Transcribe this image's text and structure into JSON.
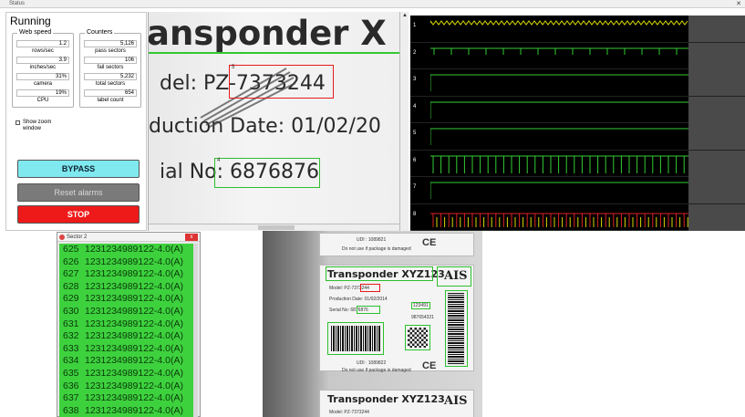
{
  "window": {
    "title": "Status"
  },
  "control_panel": {
    "status": "Running",
    "web_speed_group": {
      "title": "Web speed",
      "stats": [
        {
          "value": "1.2",
          "label": "rows/sec"
        },
        {
          "value": "3.9",
          "label": "inches/sec"
        },
        {
          "value": "31%",
          "label": "camera"
        },
        {
          "value": "19%",
          "label": "CPU"
        }
      ]
    },
    "counters_group": {
      "title": "Counters",
      "stats": [
        {
          "value": "5,126",
          "label": "pass sectors"
        },
        {
          "value": "106",
          "label": "fail sectors"
        },
        {
          "value": "5,232",
          "label": "total sectors"
        },
        {
          "value": "654",
          "label": "label count"
        }
      ]
    },
    "zoom_checkbox": {
      "label": "Show zoom window",
      "checked": true
    },
    "buttons": {
      "bypass": "BYPASS",
      "reset": "Reset alarms",
      "stop": "STOP"
    }
  },
  "label_image": {
    "title_text": "ansponder X",
    "model_text": "del: PZ-7373244",
    "date_text": "duction Date:  01/02/20",
    "serial_text": "ial No: 6876876",
    "roi_numbers": [
      "5",
      "4"
    ]
  },
  "signal_panel": {
    "channels": [
      {
        "num": "1",
        "color": "#d8d800",
        "pattern": "dense"
      },
      {
        "num": "2",
        "color": "#33cc33",
        "pattern": "sparse"
      },
      {
        "num": "3",
        "color": "#33cc33",
        "pattern": "flat"
      },
      {
        "num": "4",
        "color": "#33cc33",
        "pattern": "flat"
      },
      {
        "num": "5",
        "color": "#33cc33",
        "pattern": "flat"
      },
      {
        "num": "6",
        "color": "#33cc33",
        "pattern": "tall"
      },
      {
        "num": "7",
        "color": "#33cc33",
        "pattern": "flat"
      },
      {
        "num": "8",
        "color": "#dd2222",
        "pattern": "mixed"
      }
    ]
  },
  "sector_window": {
    "title": "Sector 2",
    "close": "x",
    "rows": [
      {
        "idx": "625",
        "code": "1231234989122-4.0(A)"
      },
      {
        "idx": "626",
        "code": "1231234989122-4.0(A)"
      },
      {
        "idx": "627",
        "code": "1231234989122-4.0(A)"
      },
      {
        "idx": "628",
        "code": "1231234989122-4.0(A)"
      },
      {
        "idx": "629",
        "code": "1231234989122-4.0(A)"
      },
      {
        "idx": "630",
        "code": "1231234989122-4.0(A)"
      },
      {
        "idx": "631",
        "code": "1231234989122-4.0(A)"
      },
      {
        "idx": "632",
        "code": "1231234989122-4.0(A)"
      },
      {
        "idx": "633",
        "code": "1231234989122-4.0(A)"
      },
      {
        "idx": "634",
        "code": "1231234989122-4.0(A)"
      },
      {
        "idx": "635",
        "code": "1231234989122-4.0(A)"
      },
      {
        "idx": "636",
        "code": "1231234989122-4.0(A)"
      },
      {
        "idx": "637",
        "code": "1231234989122-4.0(A)"
      },
      {
        "idx": "638",
        "code": "1231234989122-4.0(A)"
      }
    ]
  },
  "bottom_image": {
    "card_a": {
      "udi": "UDI : 1089821",
      "warning": "Do not use if package is damaged",
      "ce": "CE"
    },
    "card_b": {
      "title": "Transponder XYZ123",
      "ais": "AIS",
      "model": "Model: PZ-7373244",
      "date": "Production Date:  01/02/2014",
      "serial": "Serial No: 6876876",
      "lot": "123491",
      "ref": "987654321",
      "udi": "UDI : 1089822",
      "warning": "Do not use if package is damaged",
      "ce": "CE"
    },
    "card_c": {
      "title": "Transponder XYZ123",
      "ais": "AIS",
      "model": "Model: PZ-7373244"
    }
  }
}
